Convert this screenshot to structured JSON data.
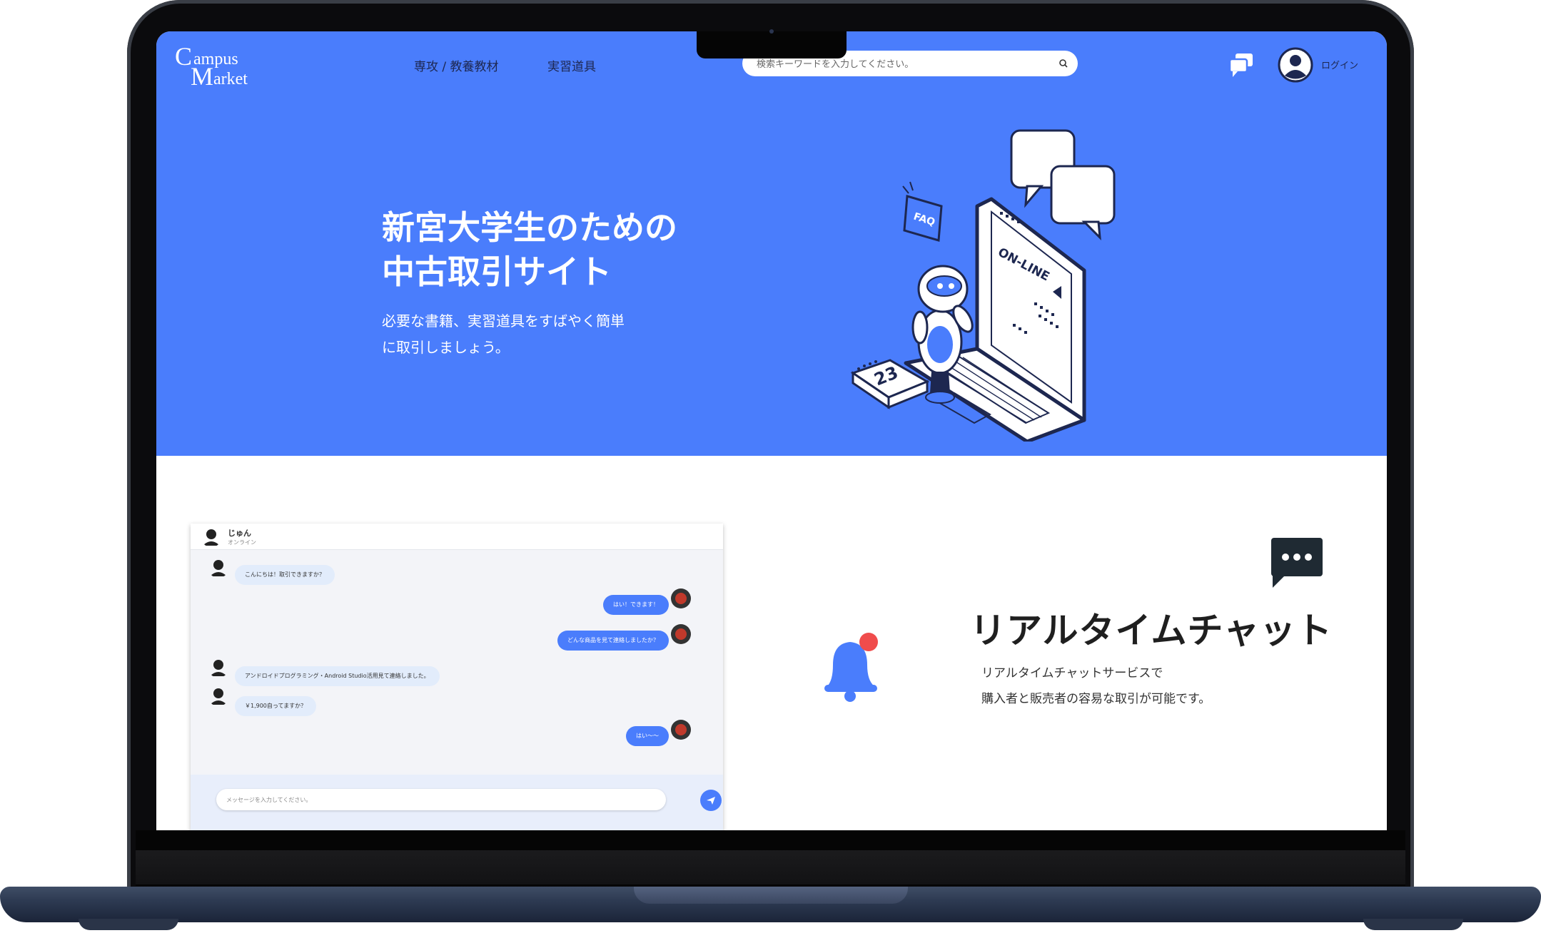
{
  "logo": {
    "c": "C",
    "ampus": "ampus",
    "m": "M",
    "arket": "arket"
  },
  "nav": {
    "links": [
      "専攻 / 教養教材",
      "実習道具"
    ],
    "search_placeholder": "検索キーワードを入力してください。",
    "login_label": "ログイン"
  },
  "hero": {
    "title_line1": "新宮大学生のための",
    "title_line2": "中古取引サイト",
    "subtitle_line1": "必要な書籍、実習道具をすばやく簡単",
    "subtitle_line2": "に取引しましょう。",
    "illustration_labels": {
      "faq": "FAQ",
      "online": "ON-LINE",
      "calendar_day": "23"
    }
  },
  "chat": {
    "contact_name": "じゅん",
    "contact_status": "オンライン",
    "messages": [
      {
        "side": "left",
        "text": "こんにちは！取引できますか？"
      },
      {
        "side": "right",
        "text": "はい！できます！"
      },
      {
        "side": "right",
        "text": "どんな商品を見て連絡しましたか？"
      },
      {
        "side": "left",
        "text": "アンドロイドプログラミング・Android Studio活用見て連絡しました。"
      },
      {
        "side": "left",
        "text": "￥1,900自ってますか？"
      },
      {
        "side": "right",
        "text": "はい〜〜"
      }
    ],
    "input_placeholder": "メッセージを入力してください。"
  },
  "feature": {
    "title": "リアルタイムチャット",
    "desc_line1": "リアルタイムチャットサービスで",
    "desc_line2": "購入者と販売者の容易な取引が可能です。"
  },
  "colors": {
    "brand_blue": "#4a7dfc",
    "nav_text": "#1d2750",
    "bell_dot": "#f04c4c",
    "laptop_body": "#0b0b0d",
    "laptop_base": "#2d3a52"
  },
  "icons": [
    "search-icon",
    "chat-bubbles-icon",
    "user-circle-icon",
    "send-icon",
    "bell-icon",
    "speech-bubble-icon"
  ]
}
